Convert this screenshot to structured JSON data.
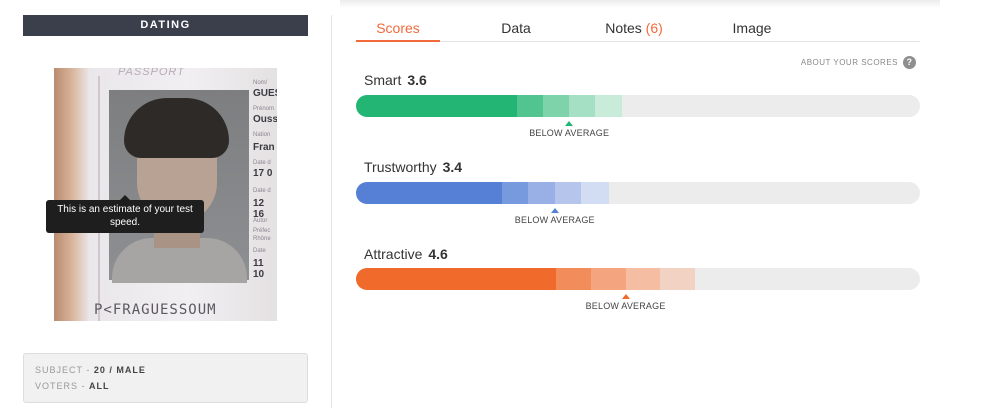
{
  "category": "DATING",
  "photo": {
    "passport_label": "PASSPORT",
    "fields": [
      "Nom/",
      "Prénom",
      "Nation",
      "Date d",
      "Date d",
      "Autor",
      "Préfec",
      "Rhône",
      "Date"
    ],
    "values": [
      "GUES",
      "Ouss",
      "Fran",
      "17 0",
      "12 16",
      "11 10"
    ],
    "mrz": "P<FRAGUESSOUM"
  },
  "tooltip": "This is an estimate of your test speed.",
  "subject": {
    "label": "SUBJECT",
    "value": "20 / MALE"
  },
  "voters": {
    "label": "VOTERS",
    "value": "ALL"
  },
  "tabs": [
    {
      "label": "Scores",
      "active": true
    },
    {
      "label": "Data"
    },
    {
      "label": "Notes",
      "count": "(6)"
    },
    {
      "label": "Image"
    }
  ],
  "about": {
    "label": "ABOUT YOUR SCORES",
    "icon": "help-icon"
  },
  "scores": [
    {
      "name": "Smart",
      "value": "3.6",
      "level": "BELOW AVERAGE",
      "fill": 0.286,
      "range": [
        0.286,
        0.47
      ],
      "colors": [
        "#23b573",
        "#52c48f",
        "#7fd3ab",
        "#a6e0c4",
        "#c9ebda"
      ]
    },
    {
      "name": "Trustworthy",
      "value": "3.4",
      "level": "BELOW AVERAGE",
      "fill": 0.258,
      "range": [
        0.258,
        0.447
      ],
      "colors": [
        "#5580d6",
        "#7799de",
        "#98b0e5",
        "#b5c5ec",
        "#d2dcf2"
      ]
    },
    {
      "name": "Attractive",
      "value": "4.6",
      "level": "BELOW AVERAGE",
      "fill": 0.355,
      "range": [
        0.355,
        0.601
      ],
      "colors": [
        "#f06b2b",
        "#f28c5a",
        "#f4a47f",
        "#f5bda2",
        "#f2d3c3"
      ]
    }
  ]
}
